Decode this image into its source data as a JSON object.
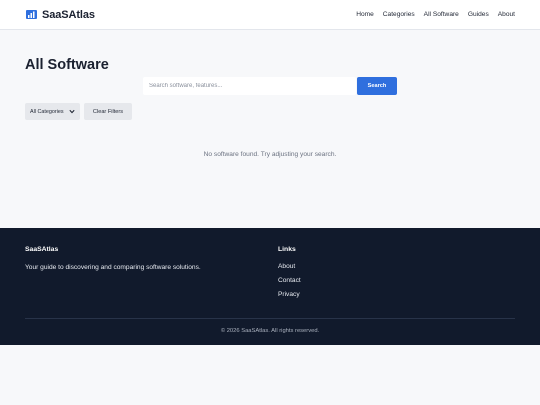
{
  "brand": {
    "name": "SaaSAtlas",
    "icon": "bar-chart-logo-icon",
    "accent_color": "#2f6fde"
  },
  "nav": {
    "items": [
      {
        "label": "Home"
      },
      {
        "label": "Categories"
      },
      {
        "label": "All Software"
      },
      {
        "label": "Guides"
      },
      {
        "label": "About"
      }
    ]
  },
  "main": {
    "title": "All Software",
    "search": {
      "placeholder": "Search software, features...",
      "value": "",
      "button_label": "Search"
    },
    "filters": {
      "category_selected": "All Categories",
      "clear_label": "Clear Filters"
    },
    "empty_message": "No software found. Try adjusting your search."
  },
  "footer": {
    "brand_title": "SaaSAtlas",
    "tagline": "Your guide to discovering and comparing software solutions.",
    "links_title": "Links",
    "links": [
      {
        "label": "About"
      },
      {
        "label": "Contact"
      },
      {
        "label": "Privacy"
      }
    ],
    "copyright": "© 2026 SaaSAtlas. All rights reserved.",
    "background_color": "#111a2c"
  }
}
